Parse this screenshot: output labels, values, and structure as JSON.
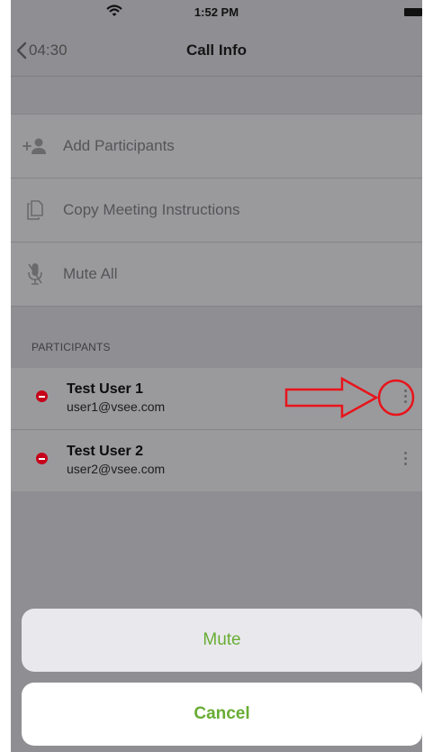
{
  "status_bar": {
    "time": "1:52 PM"
  },
  "nav": {
    "back_label": "04:30",
    "title": "Call Info"
  },
  "actions": [
    {
      "label": "Add Participants",
      "icon": "add-person-icon"
    },
    {
      "label": "Copy Meeting Instructions",
      "icon": "copy-document-icon"
    },
    {
      "label": "Mute All",
      "icon": "microphone-muted-icon"
    }
  ],
  "participants_section": {
    "header": "PARTICIPANTS",
    "items": [
      {
        "name": "Test User 1",
        "email": "user1@vsee.com",
        "status_icon": "do-not-disturb-icon"
      },
      {
        "name": "Test User 2",
        "email": "user2@vsee.com",
        "status_icon": "do-not-disturb-icon"
      }
    ]
  },
  "action_sheet": {
    "primary_label": "Mute",
    "cancel_label": "Cancel"
  },
  "colors": {
    "accent": "#68ad35",
    "status_busy": "#c6001a",
    "annotation": "#e8141b"
  }
}
